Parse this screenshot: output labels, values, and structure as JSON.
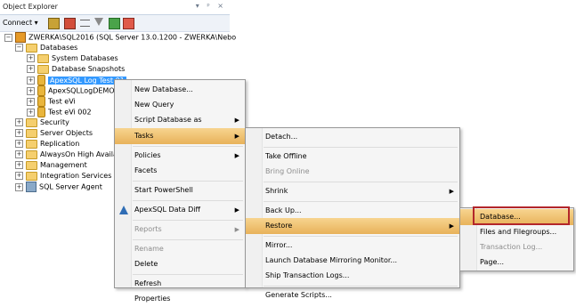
{
  "object_explorer": {
    "title": "Object Explorer",
    "title_buttons": "▾ ᵖ ×",
    "connect_label": "Connect ▾"
  },
  "tree": {
    "server": "ZWERKA\\SQL2016 (SQL Server 13.0.1200 - ZWERKA\\Nebo",
    "databases": "Databases",
    "system_databases": "System Databases",
    "database_snapshots": "Database Snapshots",
    "db_selected": "ApexSQL Log Test 01",
    "db_2": "ApexSQLLogDEMO",
    "db_3": "Test eVi",
    "db_4": "Test eVi 002",
    "security": "Security",
    "server_objects": "Server Objects",
    "replication": "Replication",
    "alwayson": "AlwaysOn High Availab",
    "management": "Management",
    "integration": "Integration Services Ca",
    "agent": "SQL Server Agent"
  },
  "menu1": {
    "new_database": "New Database...",
    "new_query": "New Query",
    "script_database_as": "Script Database as",
    "tasks": "Tasks",
    "policies": "Policies",
    "facets": "Facets",
    "start_powershell": "Start PowerShell",
    "apexsql_data_diff": "ApexSQL Data Diff",
    "reports": "Reports",
    "rename": "Rename",
    "delete": "Delete",
    "refresh": "Refresh",
    "properties": "Properties"
  },
  "menu2": {
    "detach": "Detach...",
    "take_offline": "Take Offline",
    "bring_online": "Bring Online",
    "shrink": "Shrink",
    "back_up": "Back Up...",
    "restore": "Restore",
    "mirror": "Mirror...",
    "launch_mirroring": "Launch Database Mirroring Monitor...",
    "ship_logs": "Ship Transaction Logs...",
    "generate_scripts": "Generate Scripts..."
  },
  "menu3": {
    "database": "Database...",
    "files_filegroups": "Files and Filegroups...",
    "transaction_log": "Transaction Log...",
    "page": "Page..."
  },
  "colors": {
    "highlight": "#e8b25a",
    "selection": "#3399ff",
    "frame": "#b3262a"
  }
}
